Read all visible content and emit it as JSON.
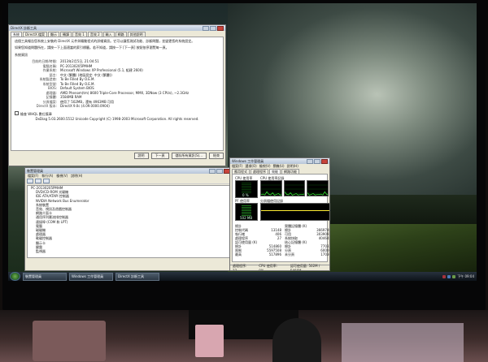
{
  "dxdiag": {
    "title": "DirectX 診斷工具",
    "tabs": [
      "系統",
      "DirectX 檔案",
      "顯示",
      "轉譯",
      "音效 1",
      "音效 2",
      "輸入",
      "網路",
      "其他說明"
    ],
    "intro": [
      "這個工具報告您系統上安裝的 DirectX 元件與驅動程式的詳細資訊。它可以讓您測試功能、診斷問題，並變更您的系統設定。",
      "如果您知道問題所在，請按一下上面適當的索引標籤。若不知道，請按一下 [下一頁] 按鈕依序瀏覽每一頁。"
    ],
    "section_title": "系統資訊",
    "fields": [
      {
        "label": "目前的日期/時間:",
        "value": "2013年2月5日, 21:04:51"
      },
      {
        "label": "電腦名稱:",
        "value": "PC-20130205PMHM"
      },
      {
        "label": "作業系統:",
        "value": "Microsoft Windows XP Professional (5.1, 組建 2600)"
      },
      {
        "label": "語言:",
        "value": "中文 (繁體) (地區設定: 中文 (繁體))"
      },
      {
        "label": "系統製造商:",
        "value": "To Be Filled By O.E.M."
      },
      {
        "label": "系統型號:",
        "value": "To Be Filled By O.E.M."
      },
      {
        "label": "BIOS:",
        "value": "Default System BIOS"
      },
      {
        "label": "處理器:",
        "value": "AMD Phenom(tm) 8600 Triple-Core Processor, MMX, 3DNow (3 CPUs), ~2.3GHz"
      },
      {
        "label": "記憶體:",
        "value": "3584MB RAM"
      },
      {
        "label": "分頁檔案:",
        "value": "使用了 502MB，還有 4963MB 可用"
      },
      {
        "label": "DirectX 版本:",
        "value": "DirectX 9.0c (4.09.0000.0904)"
      }
    ],
    "checkbox_label": "檢查 WHQL 數位簽章",
    "copyright": "DxDiag 5.03.2600.5512 Unicode Copyright (C) 1998-2003 Microsoft Corporation. All rights reserved.",
    "buttons": {
      "help": "說明",
      "next": "下一頁",
      "save": "儲存所有資訊(S)...",
      "exit": "結束"
    }
  },
  "devmgr": {
    "title": "裝置管理員",
    "menu": [
      "檔案(F)",
      "執行(A)",
      "檢視(V)",
      "說明(H)"
    ],
    "items": [
      {
        "label": "PC-20130205PMHM",
        "child": false
      },
      {
        "label": "DVD/CD-ROM 光碟機",
        "child": true
      },
      {
        "label": "IDE ATA/ATAPI 控制器",
        "child": true
      },
      {
        "label": "NVIDIA Network Bus Enumerator",
        "child": true
      },
      {
        "label": "系統裝置",
        "child": true
      },
      {
        "label": "音效、視訊及遊戲控制器",
        "child": true
      },
      {
        "label": "網路介面卡",
        "child": true
      },
      {
        "label": "通用序列匯流排控制器",
        "child": true
      },
      {
        "label": "連接埠 (COM 和 LPT)",
        "child": true
      },
      {
        "label": "電腦",
        "child": true
      },
      {
        "label": "磁碟機",
        "child": true
      },
      {
        "label": "處理器",
        "child": true
      },
      {
        "label": "軟碟控制器",
        "child": true
      },
      {
        "label": "顯示卡",
        "child": true
      },
      {
        "label": "鍵盤",
        "child": true
      },
      {
        "label": "監視器",
        "child": true
      }
    ]
  },
  "taskmgr": {
    "title": "Windows 工作管理員",
    "menu": [
      "檔案(F)",
      "選項(O)",
      "檢視(V)",
      "關機(U)",
      "說明(H)"
    ],
    "tabs": [
      "應用程式",
      "處理程序",
      "效能",
      "網路功能"
    ],
    "labels": {
      "cpu_usage": "CPU 使用率",
      "cpu_history": "CPU 使用率記錄",
      "pf_usage": "PF 使用率",
      "pf_history": "分頁檔使用記錄"
    },
    "cpu_value": "0 %",
    "pf_value": "502 MB",
    "stats_left": [
      {
        "label": "總計",
        "value": ""
      },
      {
        "label": "控制代碼",
        "value": "13148"
      },
      {
        "label": "執行緒",
        "value": "406"
      },
      {
        "label": "處理程序",
        "value": "27"
      },
      {
        "label": "認可使用量 (K)",
        "value": ""
      },
      {
        "label": "總計",
        "value": "514860"
      },
      {
        "label": "限制",
        "value": "5597508"
      },
      {
        "label": "最高",
        "value": "517896"
      }
    ],
    "stats_right": [
      {
        "label": "實體記憶體 (K)",
        "value": ""
      },
      {
        "label": "總計",
        "value": "3669740"
      },
      {
        "label": "可用",
        "value": "3039092"
      },
      {
        "label": "系統快取",
        "value": "404648"
      },
      {
        "label": "核心記憶體 (K)",
        "value": ""
      },
      {
        "label": "總計",
        "value": "77032"
      },
      {
        "label": "分頁",
        "value": "60000"
      },
      {
        "label": "未分頁",
        "value": "17036"
      }
    ],
    "status": {
      "processes": "處理程序: 27",
      "cpu": "CPU 使用率: 0%",
      "commit": "認可使用量: 502M / 5466M"
    }
  },
  "taskbar": {
    "tasks": [
      "裝置管理員",
      "Windows 工作管理員",
      "DirectX 診斷工具"
    ],
    "clock": "下午 09:04"
  },
  "cpu_history": [
    0.08,
    0.12,
    0.05,
    0.3,
    0.1,
    0.06,
    0.22,
    0.04,
    0.1,
    0.15,
    0.05,
    0.08
  ]
}
